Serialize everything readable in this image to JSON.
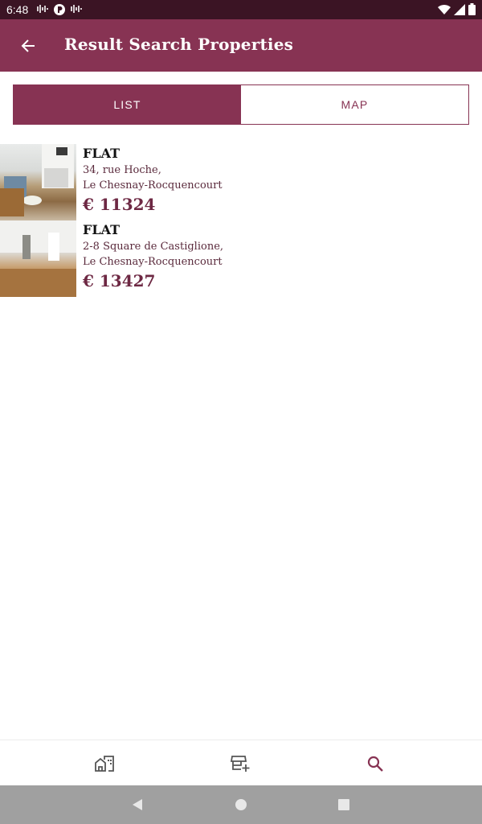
{
  "status_bar": {
    "time": "6:48"
  },
  "app_bar": {
    "title": "Result Search Properties"
  },
  "view_toggle": {
    "list_label": "LIST",
    "map_label": "MAP",
    "selected": "LIST"
  },
  "results": [
    {
      "type": "FLAT",
      "address_line1": "34, rue Hoche,",
      "address_line2": "Le Chesnay-Rocquencourt",
      "price": "€ 11324"
    },
    {
      "type": "FLAT",
      "address_line1": "2-8 Square de Castiglione,",
      "address_line2": "Le Chesnay-Rocquencourt",
      "price": "€ 13427"
    }
  ],
  "bottom_nav": {
    "items": [
      {
        "icon": "home-city-icon"
      },
      {
        "icon": "add-store-icon"
      },
      {
        "icon": "search-icon",
        "active": true
      }
    ]
  },
  "colors": {
    "primary": "#873353",
    "status_bar": "#3b1424",
    "price": "#6d2843"
  }
}
